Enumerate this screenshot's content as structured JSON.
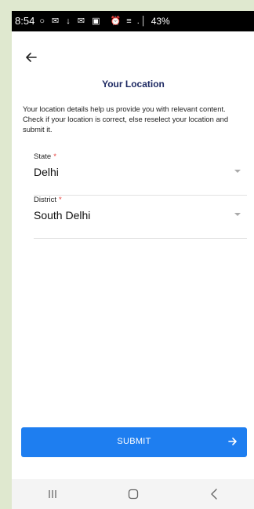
{
  "status_bar": {
    "time": "8:54",
    "notification_icons": "○ ✉ ↓ ✉ ▣",
    "system_icons": "⏰ ≡ .│",
    "battery": "43%"
  },
  "header": {
    "title": "Your Location"
  },
  "description": "Your location details help us provide you with relevant content. Check if your location is correct, else reselect your location and submit it.",
  "fields": [
    {
      "label": "State",
      "required_marker": "*",
      "value": "Delhi"
    },
    {
      "label": "District",
      "required_marker": "*",
      "value": "South Delhi"
    }
  ],
  "submit": {
    "label": "SUBMIT"
  },
  "icons": {
    "back": "back-arrow-icon",
    "dropdown": "chevron-down-icon",
    "submit_arrow": "arrow-right-icon",
    "nav_recent": "recent-apps-icon",
    "nav_home": "home-icon",
    "nav_back": "back-icon"
  },
  "colors": {
    "accent": "#1e7ef0",
    "title": "#1e2a63",
    "required": "#e53935",
    "page_background": "#dfe8cf"
  }
}
